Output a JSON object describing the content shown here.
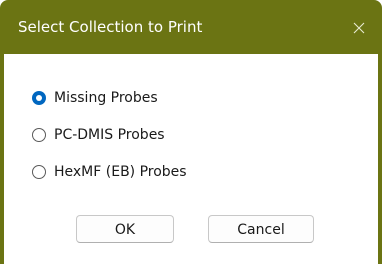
{
  "window": {
    "title": "Select Collection to Print",
    "close_glyph": "✕"
  },
  "options": [
    {
      "label": "Missing Probes",
      "checked": true
    },
    {
      "label": "PC-DMIS Probes",
      "checked": false
    },
    {
      "label": "HexMF (EB) Probes",
      "checked": false
    }
  ],
  "buttons": {
    "ok": "OK",
    "cancel": "Cancel"
  },
  "colors": {
    "titlebar": "#6b7413",
    "accent": "#0067c0",
    "title_text": "#ffffff"
  }
}
